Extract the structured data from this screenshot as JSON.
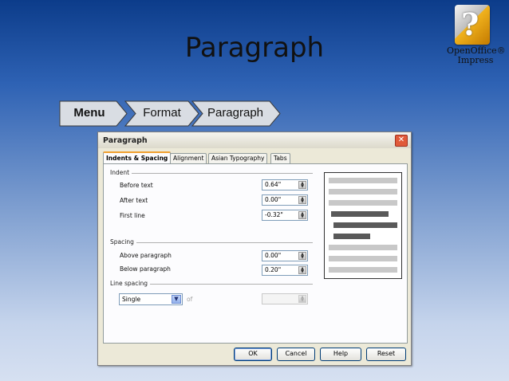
{
  "slide": {
    "title": "Paragraph"
  },
  "logo": {
    "name": "OpenOffice®",
    "product": "Impress"
  },
  "breadcrumb": {
    "items": [
      "Menu",
      "Format",
      "Paragraph"
    ]
  },
  "dialog": {
    "title": "Paragraph",
    "close_symbol": "✕",
    "tabs": [
      "Indents & Spacing",
      "Alignment",
      "Asian Typography",
      "Tabs"
    ],
    "active_tab": 0,
    "indent": {
      "group_label": "Indent",
      "before_text": {
        "label": "Before text",
        "value": "0.64\""
      },
      "after_text": {
        "label": "After text",
        "value": "0.00\""
      },
      "first_line": {
        "label": "First line",
        "value": "-0.32\""
      }
    },
    "spacing": {
      "group_label": "Spacing",
      "above_paragraph": {
        "label": "Above paragraph",
        "value": "0.00\""
      },
      "below_paragraph": {
        "label": "Below paragraph",
        "value": "0.20\""
      }
    },
    "line_spacing": {
      "group_label": "Line spacing",
      "selected": "Single",
      "of_label": "of",
      "of_value": ""
    },
    "buttons": {
      "ok": "OK",
      "cancel": "Cancel",
      "help": "Help",
      "reset": "Reset"
    }
  },
  "colors": {
    "preview_light": "#c8c8c8",
    "preview_dark": "#595959",
    "tab_accent": "#f0a030"
  }
}
